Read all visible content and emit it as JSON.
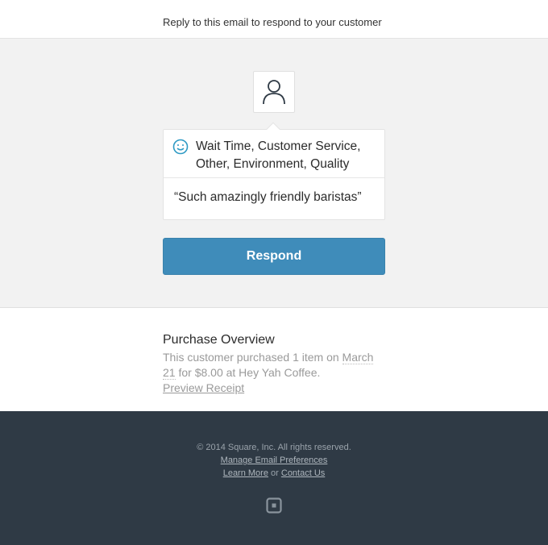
{
  "header": {
    "reply_text": "Reply to this email to respond to your customer"
  },
  "feedback": {
    "tags": "Wait Time, Customer Service, Other, Environment, Quality",
    "quote": "“Such amazingly friendly baristas”",
    "sentiment_icon": "smile-icon",
    "accent_color": "#2e9ac4"
  },
  "respond_button": {
    "label": "Respond",
    "color": "#3f8cba"
  },
  "purchase": {
    "title": "Purchase Overview",
    "text_before_date": "This customer purchased 1 item on ",
    "date_part1": "March",
    "date_part2": "21",
    "text_after_date": " for $8.00 at Hey Yah  Coffee.",
    "preview_link": "Preview Receipt"
  },
  "footer": {
    "copyright": "© 2014 Square, Inc. All rights reserved.",
    "manage_prefs": "Manage Email Preferences",
    "learn_more": "Learn More",
    "or_text": " or ",
    "contact_us": "Contact Us",
    "logo_icon": "square-logo-icon",
    "bg_color": "#2f3a45"
  }
}
